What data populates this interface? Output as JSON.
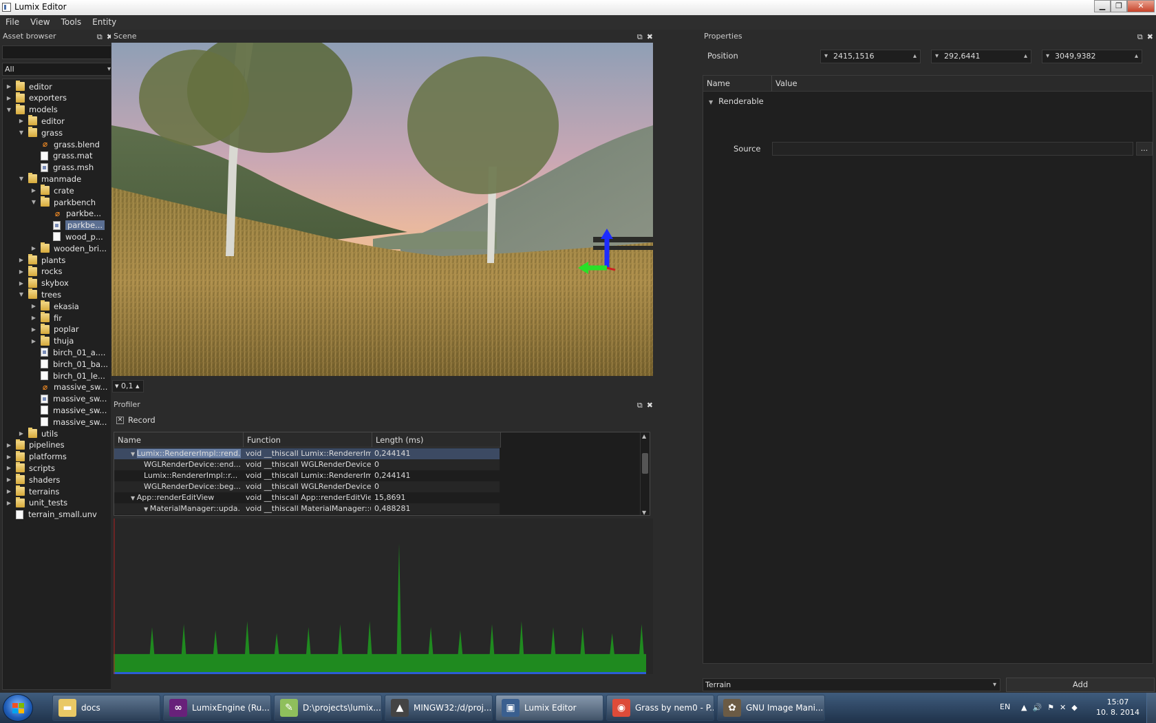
{
  "window": {
    "title": "Lumix Editor"
  },
  "menu": [
    "File",
    "View",
    "Tools",
    "Entity"
  ],
  "asset_browser": {
    "title": "Asset browser",
    "filter": "All",
    "tree": [
      {
        "label": "editor",
        "icon": "folder",
        "depth": 0,
        "arrow": "collapsed"
      },
      {
        "label": "exporters",
        "icon": "folder",
        "depth": 0,
        "arrow": "collapsed"
      },
      {
        "label": "models",
        "icon": "folder",
        "depth": 0,
        "arrow": "expanded"
      },
      {
        "label": "editor",
        "icon": "folder",
        "depth": 1,
        "arrow": "collapsed"
      },
      {
        "label": "grass",
        "icon": "folder",
        "depth": 1,
        "arrow": "expanded"
      },
      {
        "label": "grass.blend",
        "icon": "blend",
        "depth": 2,
        "arrow": ""
      },
      {
        "label": "grass.mat",
        "icon": "file",
        "depth": 2,
        "arrow": ""
      },
      {
        "label": "grass.msh",
        "icon": "image",
        "depth": 2,
        "arrow": ""
      },
      {
        "label": "manmade",
        "icon": "folder",
        "depth": 1,
        "arrow": "expanded"
      },
      {
        "label": "crate",
        "icon": "folder",
        "depth": 2,
        "arrow": "collapsed"
      },
      {
        "label": "parkbench",
        "icon": "folder",
        "depth": 2,
        "arrow": "expanded"
      },
      {
        "label": "parkbe...",
        "icon": "blend",
        "depth": 3,
        "arrow": ""
      },
      {
        "label": "parkbe...",
        "icon": "image",
        "depth": 3,
        "arrow": "",
        "selected": true
      },
      {
        "label": "wood_p...",
        "icon": "file",
        "depth": 3,
        "arrow": ""
      },
      {
        "label": "wooden_bri...",
        "icon": "folder",
        "depth": 2,
        "arrow": "collapsed"
      },
      {
        "label": "plants",
        "icon": "folder",
        "depth": 1,
        "arrow": "collapsed"
      },
      {
        "label": "rocks",
        "icon": "folder",
        "depth": 1,
        "arrow": "collapsed"
      },
      {
        "label": "skybox",
        "icon": "folder",
        "depth": 1,
        "arrow": "collapsed"
      },
      {
        "label": "trees",
        "icon": "folder",
        "depth": 1,
        "arrow": "expanded"
      },
      {
        "label": "ekasia",
        "icon": "folder",
        "depth": 2,
        "arrow": "collapsed"
      },
      {
        "label": "fir",
        "icon": "folder",
        "depth": 2,
        "arrow": "collapsed"
      },
      {
        "label": "poplar",
        "icon": "folder",
        "depth": 2,
        "arrow": "collapsed"
      },
      {
        "label": "thuja",
        "icon": "folder",
        "depth": 2,
        "arrow": "collapsed"
      },
      {
        "label": "birch_01_a....",
        "icon": "image",
        "depth": 2,
        "arrow": ""
      },
      {
        "label": "birch_01_ba...",
        "icon": "file",
        "depth": 2,
        "arrow": ""
      },
      {
        "label": "birch_01_le...",
        "icon": "file",
        "depth": 2,
        "arrow": ""
      },
      {
        "label": "massive_sw...",
        "icon": "blend",
        "depth": 2,
        "arrow": ""
      },
      {
        "label": "massive_sw...",
        "icon": "image",
        "depth": 2,
        "arrow": ""
      },
      {
        "label": "massive_sw...",
        "icon": "file",
        "depth": 2,
        "arrow": ""
      },
      {
        "label": "massive_sw...",
        "icon": "file",
        "depth": 2,
        "arrow": ""
      },
      {
        "label": "utils",
        "icon": "folder",
        "depth": 1,
        "arrow": "collapsed"
      },
      {
        "label": "pipelines",
        "icon": "folder",
        "depth": 0,
        "arrow": "collapsed"
      },
      {
        "label": "platforms",
        "icon": "folder",
        "depth": 0,
        "arrow": "collapsed"
      },
      {
        "label": "scripts",
        "icon": "folder",
        "depth": 0,
        "arrow": "collapsed"
      },
      {
        "label": "shaders",
        "icon": "folder",
        "depth": 0,
        "arrow": "collapsed"
      },
      {
        "label": "terrains",
        "icon": "folder",
        "depth": 0,
        "arrow": "collapsed"
      },
      {
        "label": "unit_tests",
        "icon": "folder",
        "depth": 0,
        "arrow": "collapsed"
      },
      {
        "label": "terrain_small.unv",
        "icon": "file",
        "depth": 0,
        "arrow": ""
      }
    ]
  },
  "scene": {
    "title": "Scene",
    "speed_value": "0,1"
  },
  "profiler": {
    "title": "Profiler",
    "record_label": "Record",
    "columns": [
      "Name",
      "Function",
      "Length (ms)"
    ],
    "rows": [
      {
        "name": "Lumix::RendererImpl::rend...",
        "function": "void __thiscall Lumix::RendererImp...",
        "length": "0,244141",
        "indent": 1,
        "arrow": "expanded",
        "selected": true
      },
      {
        "name": "WGLRenderDevice::end...",
        "function": "void __thiscall WGLRenderDevice::...",
        "length": "0",
        "indent": 2,
        "arrow": ""
      },
      {
        "name": "Lumix::RendererImpl::r...",
        "function": "void __thiscall Lumix::RendererImp...",
        "length": "0,244141",
        "indent": 2,
        "arrow": ""
      },
      {
        "name": "WGLRenderDevice::beg...",
        "function": "void __thiscall WGLRenderDevice::...",
        "length": "0",
        "indent": 2,
        "arrow": ""
      },
      {
        "name": "App::renderEditView",
        "function": "void __thiscall App::renderEditView...",
        "length": "15,8691",
        "indent": 1,
        "arrow": "expanded"
      },
      {
        "name": "MaterialManager::upda...",
        "function": "void __thiscall MaterialManager::u...",
        "length": "0,488281",
        "indent": 2,
        "arrow": "expanded"
      }
    ],
    "graph_values": [
      3,
      3,
      3,
      3,
      3,
      3,
      3,
      3,
      3,
      3,
      3,
      3,
      3,
      3,
      3,
      3,
      3,
      12,
      3,
      3,
      3,
      3,
      3,
      3,
      3,
      3,
      3,
      3,
      3,
      3,
      3,
      13,
      3,
      3,
      3,
      3,
      3,
      3,
      3,
      3,
      3,
      3,
      3,
      3,
      3,
      11,
      3,
      3,
      3,
      3,
      3,
      3,
      3,
      3,
      3,
      3,
      3,
      3,
      3,
      14,
      3,
      3,
      3,
      3,
      3,
      3,
      3,
      3,
      3,
      3,
      3,
      3,
      10,
      3,
      3,
      3,
      3,
      3,
      3,
      3,
      3,
      3,
      3,
      3,
      3,
      3,
      12,
      3,
      3,
      3,
      3,
      3,
      3,
      3,
      3,
      3,
      3,
      3,
      3,
      3,
      13,
      3,
      3,
      3,
      3,
      3,
      3,
      3,
      3,
      3,
      3,
      3,
      3,
      14,
      3,
      3,
      3,
      3,
      3,
      3,
      3,
      3,
      3,
      3,
      3,
      3,
      40,
      3,
      3,
      3,
      3,
      3,
      3,
      3,
      3,
      3,
      3,
      3,
      3,
      3,
      12,
      3,
      3,
      3,
      3,
      3,
      3,
      3,
      3,
      3,
      3,
      3,
      3,
      11,
      3,
      3,
      3,
      3,
      3,
      3,
      3,
      3,
      3,
      3,
      3,
      3,
      3,
      13,
      3,
      3,
      3,
      3,
      3,
      3,
      3,
      3,
      3,
      3,
      3,
      3,
      14,
      3,
      3,
      3,
      3,
      3,
      3,
      3,
      3,
      3,
      3,
      3,
      3,
      3,
      12,
      3,
      3,
      3,
      3,
      3,
      3,
      3,
      3,
      3,
      3,
      3,
      3,
      12,
      3,
      3,
      3,
      3,
      3,
      3,
      3,
      3,
      3,
      3,
      3,
      3,
      10,
      3,
      3,
      3,
      3,
      3,
      3,
      3,
      3,
      3,
      3,
      3,
      3,
      13,
      3,
      3
    ],
    "graph_color": "#1f8a1f"
  },
  "properties": {
    "title": "Properties",
    "position_label": "Position",
    "position": [
      "2415,1516",
      "292,6441",
      "3049,9382"
    ],
    "grid_columns": [
      "Name",
      "Value"
    ],
    "component": "Renderable",
    "source_label": "Source",
    "browse_label": "...",
    "component_select": "Terrain",
    "add_label": "Add"
  },
  "taskbar": {
    "items": [
      {
        "label": "docs",
        "icon": "folder-icon",
        "color": "#e9c865"
      },
      {
        "label": "LumixEngine (Ru...",
        "icon": "visual-studio-icon",
        "color": "#68217a"
      },
      {
        "label": "D:\\projects\\lumix...",
        "icon": "notepad-icon",
        "color": "#8fbf5c"
      },
      {
        "label": "MINGW32:/d/proj...",
        "icon": "mingw-icon",
        "color": "#444444"
      },
      {
        "label": "Lumix Editor",
        "icon": "lumix-editor-icon",
        "color": "#3a5f8f",
        "active": true
      },
      {
        "label": "Grass by nem0 - P...",
        "icon": "chrome-icon",
        "color": "#dd4b39"
      },
      {
        "label": "GNU Image Mani...",
        "icon": "gimp-icon",
        "color": "#6b5b45"
      }
    ],
    "lang": "EN",
    "time": "15:07",
    "date": "10. 8. 2014"
  }
}
